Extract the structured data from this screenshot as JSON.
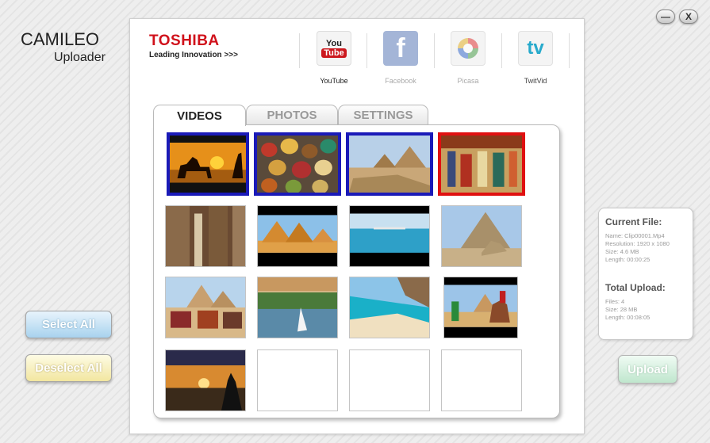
{
  "app": {
    "title": "CAMILEO",
    "subtitle": "Uploader"
  },
  "window_controls": {
    "minimize": "—",
    "close": "X"
  },
  "brand": {
    "name": "TOSHIBA",
    "tagline": "Leading Innovation >>>"
  },
  "share_services": [
    {
      "label": "YouTube",
      "icon_text_top": "You",
      "icon_text_bottom": "Tube",
      "enabled": true
    },
    {
      "label": "Facebook",
      "icon_text": "f",
      "enabled": false
    },
    {
      "label": "Picasa",
      "enabled": false
    },
    {
      "label": "TwitVid",
      "icon_text": "tv",
      "enabled": false
    }
  ],
  "tabs": [
    {
      "label": "VIDEOS",
      "active": true
    },
    {
      "label": "PHOTOS",
      "active": false
    },
    {
      "label": "SETTINGS",
      "active": false
    }
  ],
  "thumbnails": [
    {
      "subject": "camel-sunset-icon",
      "selected": "blue"
    },
    {
      "subject": "spice-market-icon",
      "selected": "blue"
    },
    {
      "subject": "giza-pyramids-icon",
      "selected": "blue"
    },
    {
      "subject": "egyptian-mural-icon",
      "selected": "red"
    },
    {
      "subject": "temple-columns-icon",
      "selected": ""
    },
    {
      "subject": "pyramids-golden-icon",
      "selected": ""
    },
    {
      "subject": "beach-sea-icon",
      "selected": ""
    },
    {
      "subject": "sphinx-pyramid-icon",
      "selected": ""
    },
    {
      "subject": "camels-pyramids-icon",
      "selected": ""
    },
    {
      "subject": "nile-felucca-icon",
      "selected": ""
    },
    {
      "subject": "turquoise-coast-icon",
      "selected": ""
    },
    {
      "subject": "camel-rider-icon",
      "selected": ""
    },
    {
      "subject": "nile-sunset-icon",
      "selected": ""
    },
    {
      "subject": "empty-slot",
      "selected": ""
    },
    {
      "subject": "empty-slot",
      "selected": ""
    },
    {
      "subject": "empty-slot",
      "selected": ""
    }
  ],
  "buttons": {
    "select_all": "Select All",
    "deselect_all": "Deselect All",
    "upload": "Upload"
  },
  "current_file": {
    "title": "Current File:",
    "name": "Name: Clip00001.Mp4",
    "resolution": "Resolution: 1920 x 1080",
    "size": "Size: 4.6 MB",
    "length": "Length: 00:00:25"
  },
  "total_upload": {
    "title": "Total Upload:",
    "files": "Files: 4",
    "size": "Size: 28 MB",
    "length": "Length: 00:08:05"
  },
  "colors": {
    "brand_red": "#d0111b",
    "select_blue": "#1a1ab8",
    "select_red": "#e01010",
    "youtube_red": "#cc181e",
    "facebook_blue": "#5b7ab8"
  }
}
